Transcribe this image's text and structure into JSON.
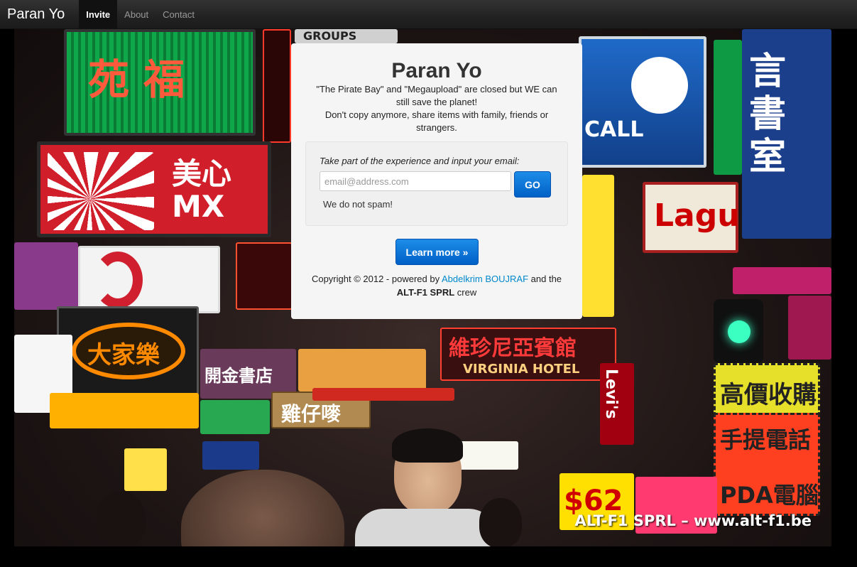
{
  "navbar": {
    "brand": "Paran Yo",
    "items": [
      {
        "label": "Invite",
        "active": true
      },
      {
        "label": "About",
        "active": false
      },
      {
        "label": "Contact",
        "active": false
      }
    ]
  },
  "hero": {
    "title": "Paran Yo",
    "description_line1": "\"The Pirate Bay\" and \"Megaupload\" are closed but WE can still save the planet!",
    "description_line2": "Don't copy anymore, share items with family, friends or strangers.",
    "form": {
      "prompt": "Take part of the experience and input your email:",
      "email_placeholder": "email@address.com",
      "email_value": "",
      "go_label": "GO",
      "nospam": "We do not spam!"
    },
    "learn_more_label": "Learn more »",
    "copyright": {
      "prefix": "Copyright © 2012 - powered by ",
      "author_link": "Abdelkrim BOUJRAF",
      "middle": " and the",
      "company": "ALT-F1 SPRL",
      "suffix": " crew"
    }
  },
  "background": {
    "watermark": "ALT-F1 SPRL – www.alt-f1.be",
    "signs": [
      {
        "text": "苑 福",
        "color": "#ff5a3c",
        "bg": "#0a8a3a"
      },
      {
        "text": "美心 MX",
        "color": "#ffffff",
        "bg": "#d01f2a"
      },
      {
        "text": "大家樂",
        "color": "#ff7a00",
        "bg": "#1a1a1a"
      },
      {
        "text": "維珍尼亞賓館",
        "color": "#ff3030",
        "bg": "#3a0f0f"
      },
      {
        "text": "VIRGINIA HOTEL",
        "color": "#ffd080",
        "bg": "#3a0f0f"
      },
      {
        "text": "高價收購",
        "color": "#222222",
        "bg": "#e6e02a"
      },
      {
        "text": "手提電話",
        "color": "#222222",
        "bg": "#ff4020"
      },
      {
        "text": "PDA電腦",
        "color": "#222222",
        "bg": "#ff4020"
      },
      {
        "text": "Levi's",
        "color": "#ffffff",
        "bg": "#a00010"
      },
      {
        "text": "$62",
        "color": "#d00000",
        "bg": "#ffe000"
      },
      {
        "text": "CALL",
        "color": "#ffffff",
        "bg": "#1a5aa8"
      },
      {
        "text": "言書室",
        "color": "#ffffff",
        "bg": "#1c3f8c"
      },
      {
        "text": "GROUPS",
        "color": "#222222",
        "bg": "#d0d0d0"
      },
      {
        "text": "Lagu",
        "color": "#cc0000",
        "bg": "#f0e8d8"
      },
      {
        "text": "雞仔嘜",
        "color": "#ffffff",
        "bg": "#b08a50"
      },
      {
        "text": "開金書店",
        "color": "#ffffff",
        "bg": "#6a3a5a"
      }
    ]
  }
}
